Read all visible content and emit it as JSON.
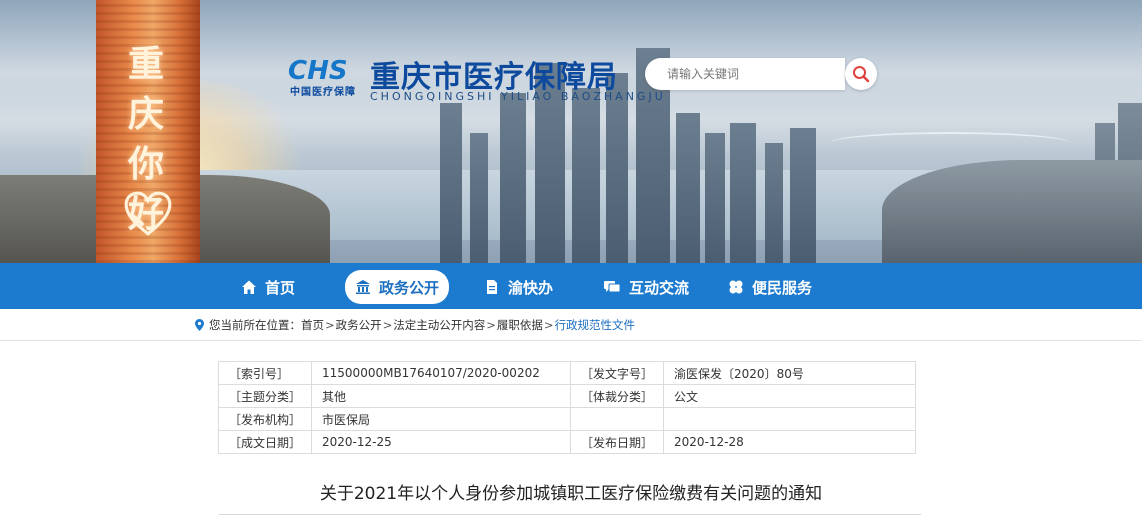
{
  "header": {
    "logo_mark": "CHS",
    "logo_sub": "中国医疗保障",
    "site_title": "重庆市医疗保障局",
    "site_pinyin": "CHONGQINGSHI  YILIAO  BAOZHANGJU",
    "banner_text": "重庆你好"
  },
  "search": {
    "placeholder": "请输入关键词"
  },
  "nav": {
    "items": [
      {
        "label": "首页",
        "icon": "home-icon"
      },
      {
        "label": "政务公开",
        "icon": "building-icon",
        "active": true
      },
      {
        "label": "渝快办",
        "icon": "document-icon"
      },
      {
        "label": "互动交流",
        "icon": "chat-icon"
      },
      {
        "label": "便民服务",
        "icon": "clover-icon"
      }
    ]
  },
  "breadcrumb": {
    "prefix": "您当前所在位置：",
    "items": [
      "首页",
      "政务公开",
      "法定主动公开内容",
      "履职依据",
      "行政规范性文件"
    ],
    "separator": ">"
  },
  "info": {
    "index_no_label": "［索引号］",
    "index_no_value": "11500000MB17640107/2020-00202",
    "doc_no_label": "［发文字号］",
    "doc_no_value": "渝医保发〔2020〕80号",
    "topic_label": "［主题分类］",
    "topic_value": "其他",
    "genre_label": "［体裁分类］",
    "genre_value": "公文",
    "publisher_label": "［发布机构］",
    "publisher_value": "市医保局",
    "created_label": "［成文日期］",
    "created_value": "2020-12-25",
    "published_label": "［发布日期］",
    "published_value": "2020-12-28"
  },
  "document": {
    "title": "关于2021年以个人身份参加城镇职工医疗保险缴费有关问题的通知"
  },
  "colors": {
    "nav_bg": "#1d7bcf",
    "brand_blue": "#0d4a9e",
    "search_icon": "#e0403c"
  }
}
